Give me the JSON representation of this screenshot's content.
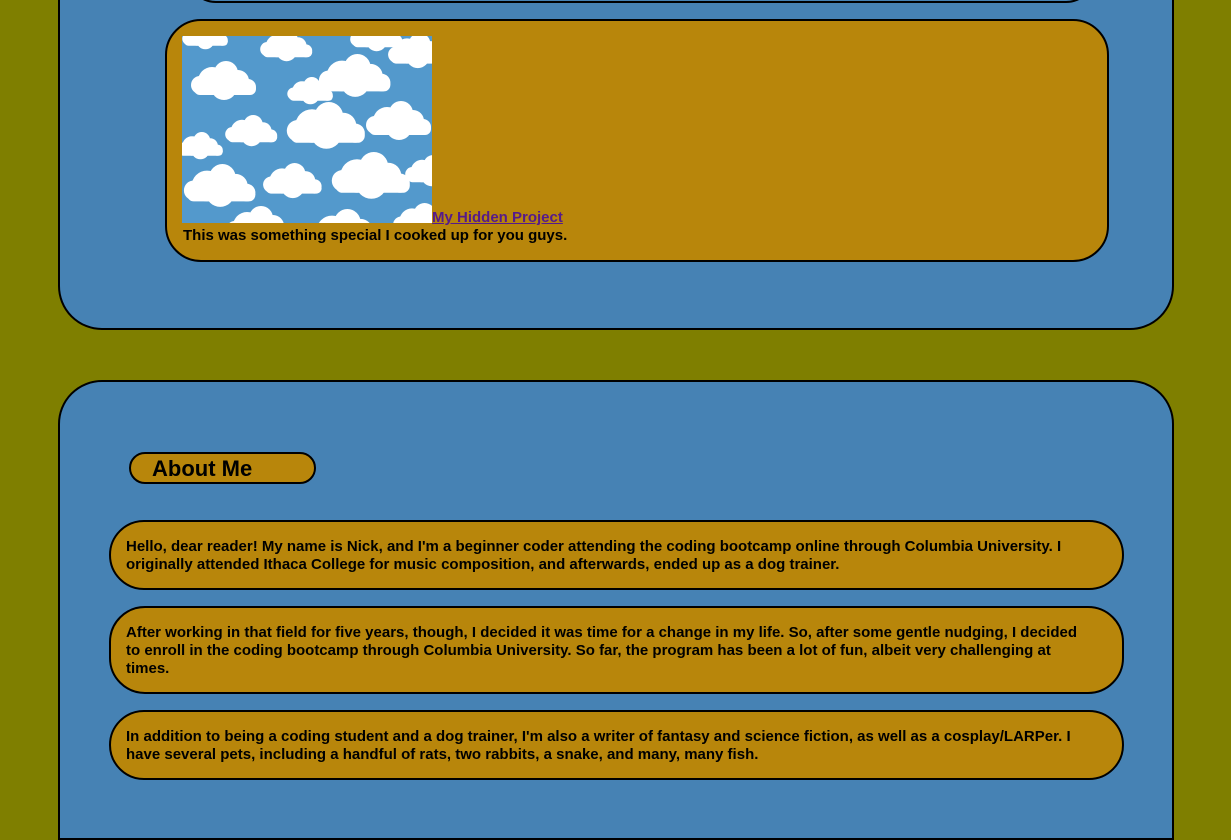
{
  "project": {
    "link_text": "My Hidden Project",
    "description": "This was something special I cooked up for you guys.",
    "thumbnail": "clouds-image"
  },
  "about": {
    "heading": "About Me",
    "paragraphs": [
      "Hello, dear reader! My name is Nick, and I'm a beginner coder attending the coding bootcamp online through Columbia University. I originally attended Ithaca College for music composition, and afterwards, ended up as a dog trainer.",
      "After working in that field for five years, though, I decided it was time for a change in my life. So, after some gentle nudging, I decided to enroll in the coding bootcamp through Columbia University. So far, the program has been a lot of fun, albeit very challenging at times.",
      "In addition to being a coding student and a dog trainer, I'm also a writer of fantasy and science fiction, as well as a cosplay/LARPer. I have several pets, including a handful of rats, two rabbits, a snake, and many, many fish."
    ]
  },
  "colors": {
    "page_background": "#7f7f00",
    "section_background": "#4682b4",
    "card_background": "#b8860b",
    "link_visited": "#551a8b"
  }
}
